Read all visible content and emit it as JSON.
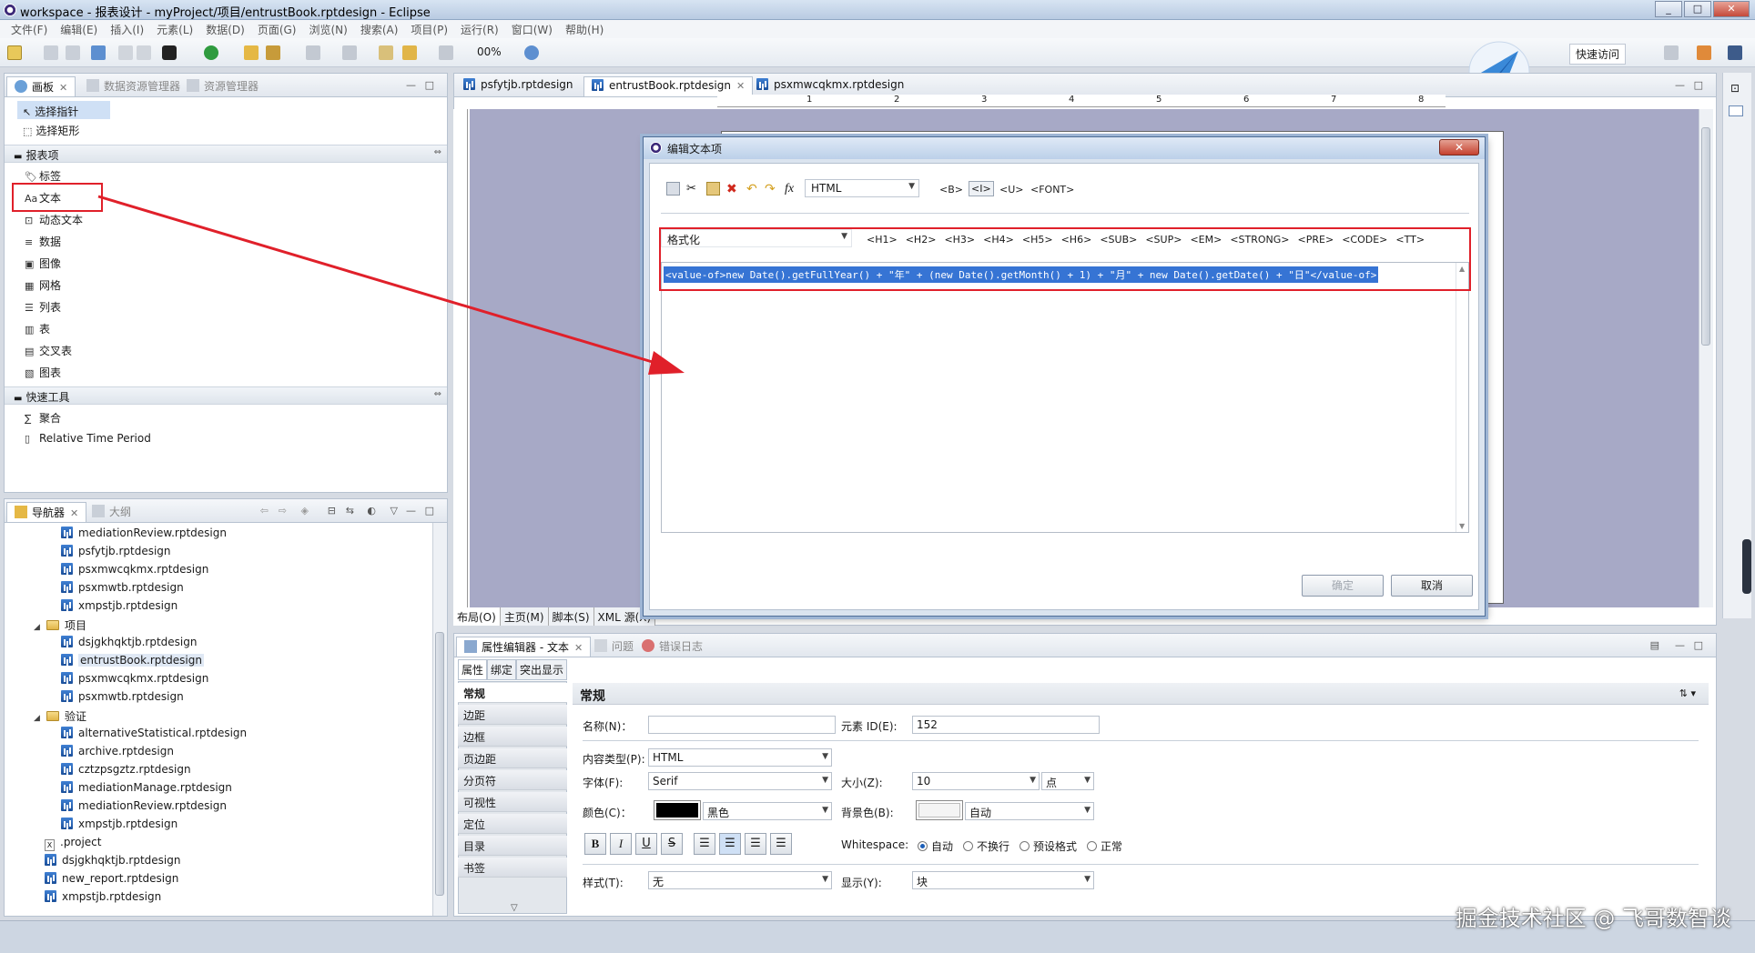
{
  "window": {
    "title": "workspace - 报表设计 - myProject/项目/entrustBook.rptdesign - Eclipse",
    "buttons": [
      "_",
      "□",
      "✕"
    ]
  },
  "menu": [
    "文件(F)",
    "编辑(E)",
    "插入(I)",
    "元素(L)",
    "数据(D)",
    "页面(G)",
    "浏览(N)",
    "搜索(A)",
    "项目(P)",
    "运行(R)",
    "窗口(W)",
    "帮助(H)"
  ],
  "toolbar": {
    "zoom": "00%",
    "quick_access": "快速访问"
  },
  "palette": {
    "tabs": [
      "画板",
      "数据资源管理器",
      "资源管理器"
    ],
    "tools": [
      "选择指针",
      "选择矩形"
    ],
    "report_items_header": "报表项",
    "report_items": [
      {
        "glyph": "🏷",
        "label": "标签"
      },
      {
        "glyph": "Aa",
        "label": "文本"
      },
      {
        "glyph": "⊡",
        "label": "动态文本"
      },
      {
        "glyph": "≡",
        "label": "数据"
      },
      {
        "glyph": "▣",
        "label": "图像"
      },
      {
        "glyph": "▦",
        "label": "网格"
      },
      {
        "glyph": "☰",
        "label": "列表"
      },
      {
        "glyph": "▥",
        "label": "表"
      },
      {
        "glyph": "▤",
        "label": "交叉表"
      },
      {
        "glyph": "▧",
        "label": "图表"
      }
    ],
    "quick_tools_header": "快速工具",
    "quick_tools": [
      {
        "glyph": "∑",
        "label": "聚合"
      },
      {
        "glyph": "▯",
        "label": "Relative Time Period"
      }
    ]
  },
  "navigator": {
    "tabs": [
      "导航器",
      "大纲"
    ],
    "items": [
      {
        "type": "rpt",
        "label": "mediationReview.rptdesign",
        "indent": 3
      },
      {
        "type": "rpt",
        "label": "psfytjb.rptdesign",
        "indent": 3
      },
      {
        "type": "rpt",
        "label": "psxmwcqkmx.rptdesign",
        "indent": 3
      },
      {
        "type": "rpt",
        "label": "psxmwtb.rptdesign",
        "indent": 3
      },
      {
        "type": "rpt",
        "label": "xmpstjb.rptdesign",
        "indent": 3
      },
      {
        "type": "folder",
        "label": "项目",
        "indent": 2
      },
      {
        "type": "rpt",
        "label": "dsjgkhqktjb.rptdesign",
        "indent": 3
      },
      {
        "type": "rpt",
        "label": "entrustBook.rptdesign",
        "indent": 3,
        "selected": true
      },
      {
        "type": "rpt",
        "label": "psxmwcqkmx.rptdesign",
        "indent": 3
      },
      {
        "type": "rpt",
        "label": "psxmwtb.rptdesign",
        "indent": 3
      },
      {
        "type": "folder",
        "label": "验证",
        "indent": 2
      },
      {
        "type": "rpt",
        "label": "alternativeStatistical.rptdesign",
        "indent": 3
      },
      {
        "type": "rpt",
        "label": "archive.rptdesign",
        "indent": 3
      },
      {
        "type": "rpt",
        "label": "cztzpsgztz.rptdesign",
        "indent": 3
      },
      {
        "type": "rpt",
        "label": "mediationManage.rptdesign",
        "indent": 3
      },
      {
        "type": "rpt",
        "label": "mediationReview.rptdesign",
        "indent": 3
      },
      {
        "type": "rpt",
        "label": "xmpstjb.rptdesign",
        "indent": 3
      },
      {
        "type": "file",
        "label": ".project",
        "indent": 2
      },
      {
        "type": "rpt",
        "label": "dsjgkhqktjb.rptdesign",
        "indent": 2
      },
      {
        "type": "rpt",
        "label": "new_report.rptdesign",
        "indent": 2
      },
      {
        "type": "rpt",
        "label": "xmpstjb.rptdesign",
        "indent": 2
      }
    ]
  },
  "editor": {
    "tabs": [
      "psfytjb.rptdesign",
      "entrustBook.rptdesign",
      "psxmwcqkmx.rptdesign"
    ],
    "bottom_tabs": [
      "布局(O)",
      "主页(M)",
      "脚本(S)",
      "XML 源(X)"
    ],
    "ruler_numbers": [
      "1",
      "2",
      "3",
      "4",
      "5",
      "6",
      "7",
      "8"
    ]
  },
  "dialog": {
    "title": "编辑文本项",
    "close": "✕",
    "content_type": "HTML",
    "inline_tags": [
      "<B>",
      "<I>",
      "<U>",
      "<FONT>"
    ],
    "format_combo": "格式化",
    "block_tags": [
      "<H1>",
      "<H2>",
      "<H3>",
      "<H4>",
      "<H5>",
      "<H6>",
      "<SUB>",
      "<SUP>",
      "<EM>",
      "<STRONG>",
      "<PRE>",
      "<CODE>",
      "<TT>"
    ],
    "code": "<value-of>new Date().getFullYear() + \"年\" + (new Date().getMonth() + 1) + \"月\" + new Date().getDate() + \"日\"</value-of>",
    "ok": "确定",
    "cancel": "取消"
  },
  "properties": {
    "tabs": [
      "属性编辑器 - 文本",
      "问题",
      "错误日志"
    ],
    "subtabs": [
      "属性",
      "绑定",
      "突出显示"
    ],
    "nav": [
      "常规",
      "边距",
      "边框",
      "页边距",
      "分页符",
      "可视性",
      "定位",
      "目录",
      "书签"
    ],
    "section_title": "常规",
    "name_label": "名称(N)：",
    "name_value": "",
    "id_label": "元素 ID(E):",
    "id_value": "152",
    "content_type_label": "内容类型(P):",
    "content_type_value": "HTML",
    "font_label": "字体(F):",
    "font_value": "Serif",
    "size_label": "大小(Z):",
    "size_value": "10",
    "size_unit": "点",
    "color_label": "颜色(C)：",
    "color_value": "黑色",
    "bg_label": "背景色(B):",
    "bg_value": "自动",
    "format_buttons": [
      "B",
      "I",
      "U",
      "S"
    ],
    "whitespace_label": "Whitespace:",
    "whitespace_options": [
      "自动",
      "不换行",
      "预设格式",
      "正常"
    ],
    "style_label": "样式(T):",
    "style_value": "无",
    "display_label": "显示(Y):",
    "display_value": "块"
  },
  "watermark": "掘金技术社区 @ 飞哥数智谈",
  "colors": {
    "accent": "#3674d4",
    "annotation": "#e0202a",
    "canvas": "#a7a9c6"
  }
}
